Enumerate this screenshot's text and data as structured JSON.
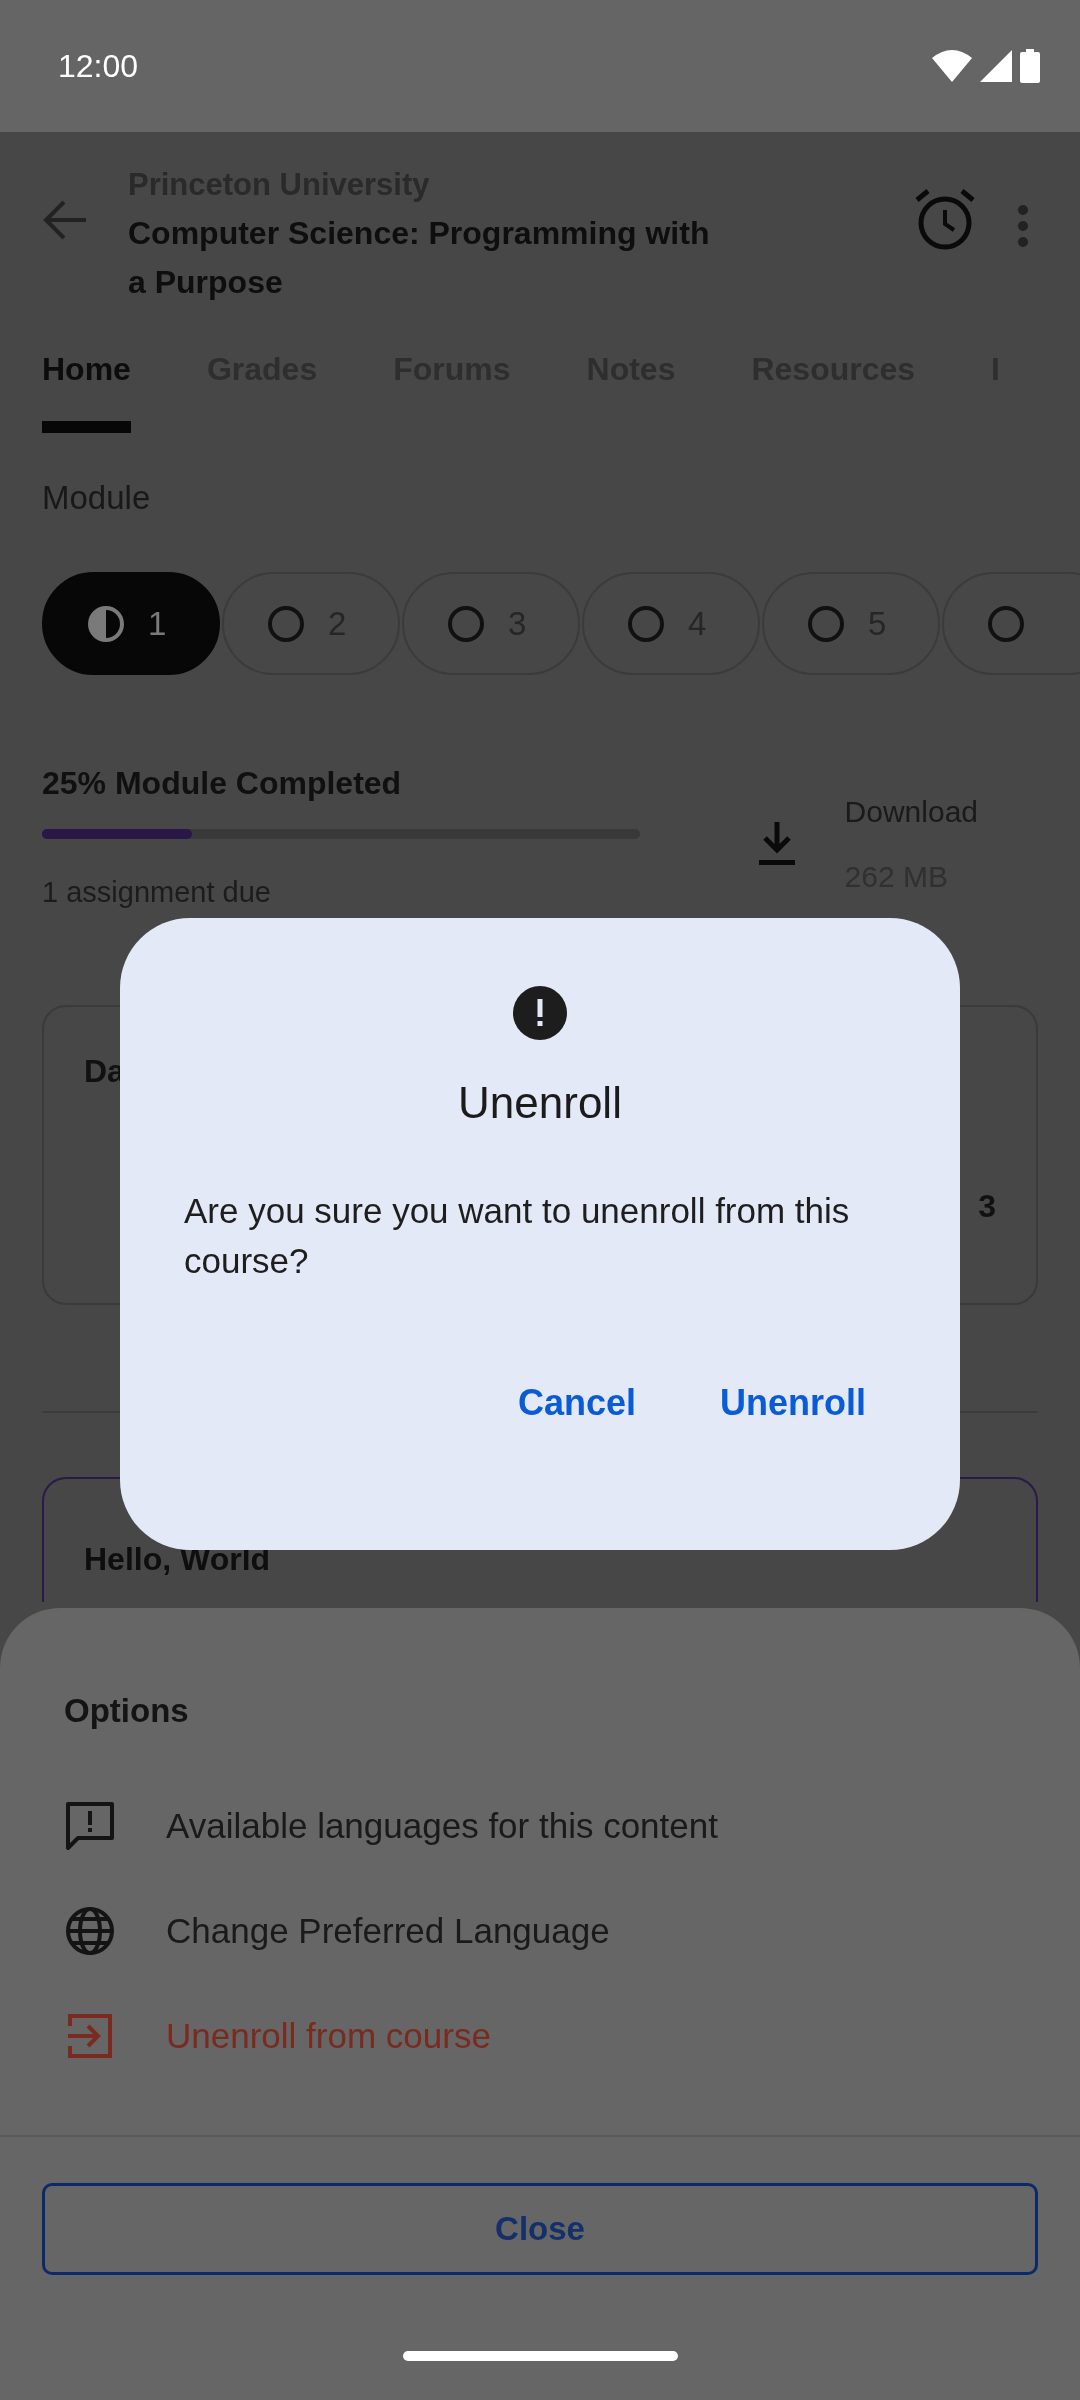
{
  "status_bar": {
    "time": "12:00"
  },
  "app_bar": {
    "subtitle": "Princeton University",
    "title": "Computer Science: Programming with a Purpose"
  },
  "tabs": [
    {
      "label": "Home",
      "selected": true
    },
    {
      "label": "Grades",
      "selected": false
    },
    {
      "label": "Forums",
      "selected": false
    },
    {
      "label": "Notes",
      "selected": false
    },
    {
      "label": "Resources",
      "selected": false
    },
    {
      "label": "I",
      "selected": false
    }
  ],
  "module": {
    "label": "Module",
    "chips": [
      {
        "label": "1",
        "started": true,
        "selected": true
      },
      {
        "label": "2",
        "started": false,
        "selected": false
      },
      {
        "label": "3",
        "started": false,
        "selected": false
      },
      {
        "label": "4",
        "started": false,
        "selected": false
      },
      {
        "label": "5",
        "started": false,
        "selected": false
      },
      {
        "started": false,
        "selected": false
      }
    ]
  },
  "progress": {
    "title": "25% Module Completed",
    "level": 0.25,
    "due": "1 assignment due"
  },
  "download": {
    "label": "Download",
    "size": "262 MB"
  },
  "dates_card": {
    "title": "Da",
    "value": "3"
  },
  "lesson_card": {
    "title": "Hello, World"
  },
  "sheet": {
    "title": "Options",
    "items": [
      {
        "label": "Available languages for this content",
        "kind": "default"
      },
      {
        "label": "Change Preferred Language",
        "kind": "default"
      },
      {
        "label": "Unenroll from course",
        "kind": "danger"
      }
    ],
    "close": "Close"
  },
  "dialog": {
    "title": "Unenroll",
    "message": "Are you sure you want to unenroll from this course?",
    "buttons": [
      {
        "label": "Cancel"
      },
      {
        "label": "Unenroll"
      }
    ]
  }
}
